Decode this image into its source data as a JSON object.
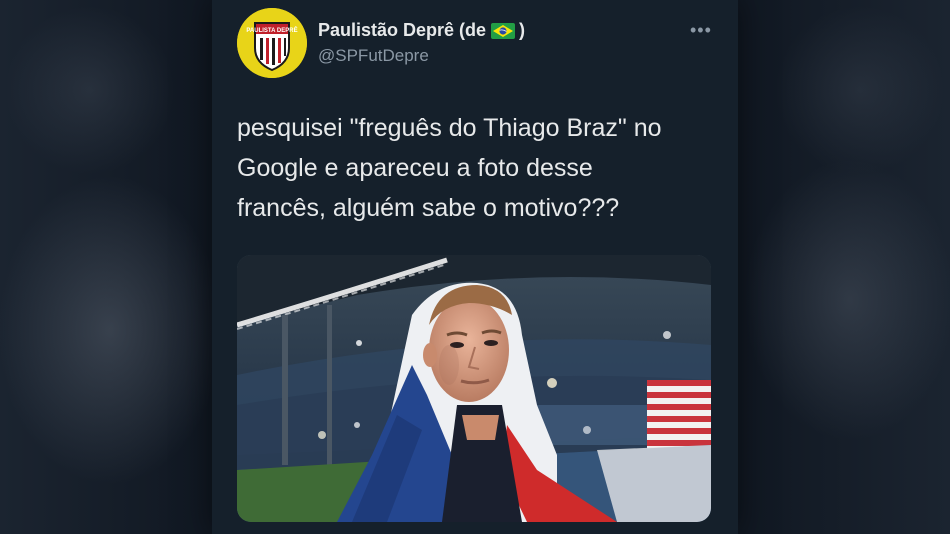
{
  "tweet": {
    "author": {
      "name": "Paulistão Deprê (de",
      "name_suffix": ")",
      "flag": "brazil-flag-icon",
      "handle": "@SPFutDepre",
      "avatar_text": "PAULISTA DEPRÊ"
    },
    "more_label": "•••",
    "text_lines": [
      "pesquisei \"freguês do Thiago Braz\" no",
      "Google e apareceu a foto desse",
      "francês, alguém sabe o motivo???"
    ],
    "media": {
      "icon": "photo-athlete-french-flag"
    }
  },
  "colors": {
    "card_bg": "#15202b",
    "text": "#e7e9ea",
    "muted": "#8b98a5",
    "avatar_bg": "#e8d418"
  }
}
